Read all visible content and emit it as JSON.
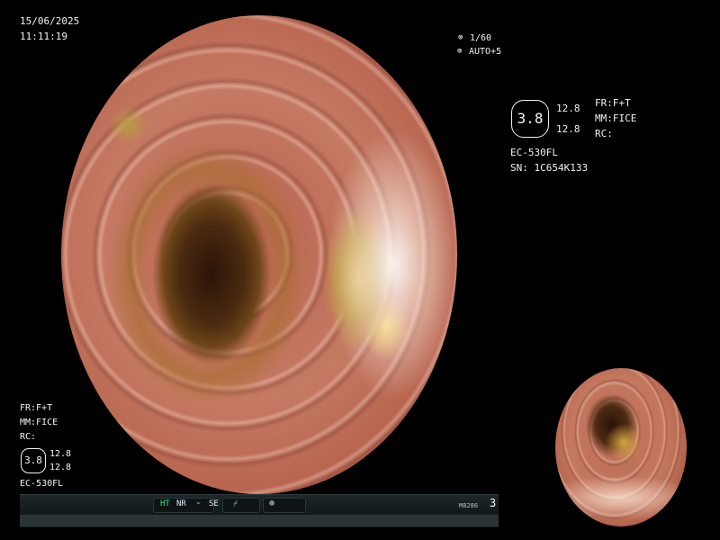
{
  "overlay": {
    "date": "15/06/2025",
    "time": "11:11:19",
    "shutter": "1/60",
    "shutter_icon": "shutter-icon",
    "auto_mode": "AUTO+5",
    "auto_icon": "auto-iris-icon"
  },
  "info_panel": {
    "badge_value": "3.8",
    "value_top": "12.8",
    "value_bottom": "12.8",
    "fr": "FR:F+T",
    "mm": "MM:FICE",
    "rc": "RC:",
    "model": "EC-530FL",
    "serial": "SN: 1C654K133"
  },
  "left_panel": {
    "fr": "FR:F+T",
    "mm": "MM:FICE",
    "rc": "RC:",
    "badge_value": "3.8",
    "value_top": "12.8",
    "value_bottom": "12.8",
    "model": "EC-530FL"
  },
  "statusbar": {
    "ht": "HT",
    "nr": "NR",
    "se_icon": "se-arrow-icon",
    "se": "SE",
    "slash_icon": "slash-icon",
    "circle_icon": "circle-mode-icon",
    "code": "M8286",
    "number": "3",
    "colors": {
      "ht": "#3de07a",
      "bar": "#141a1b"
    }
  },
  "views": {
    "main": "endoscopic-colon-view",
    "thumbnail": "endoscopic-colon-thumbnail"
  }
}
